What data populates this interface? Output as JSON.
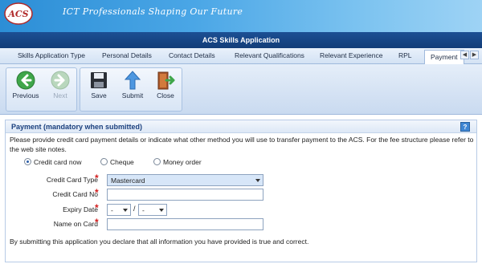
{
  "header": {
    "logo_text": "ACS",
    "tagline": "ICT Professionals Shaping Our Future"
  },
  "window": {
    "title": "ACS Skills Application"
  },
  "tabs": [
    {
      "label": "Skills Application Type"
    },
    {
      "label": "Personal Details"
    },
    {
      "label": "Contact Details"
    },
    {
      "label": "Relevant Qualifications"
    },
    {
      "label": "Relevant Experience"
    },
    {
      "label": "RPL"
    },
    {
      "label": "Payment",
      "active": true
    }
  ],
  "toolbar": {
    "previous_label": "Previous",
    "next_label": "Next",
    "save_label": "Save",
    "submit_label": "Submit",
    "close_label": "Close"
  },
  "section": {
    "title": "Payment (mandatory when submitted)",
    "help": "?",
    "intro": "Please provide credit card payment details or indicate what other method you will use to transfer payment to the ACS. For the fee structure please refer to the web site notes."
  },
  "payment_methods": [
    {
      "label": "Credit card now",
      "selected": true
    },
    {
      "label": "Cheque",
      "selected": false
    },
    {
      "label": "Money order",
      "selected": false
    }
  ],
  "form": {
    "card_type_label": "Credit Card Type",
    "card_type_value": "Mastercard",
    "card_no_label": "Credit Card No",
    "card_no_value": "",
    "expiry_label": "Expiry Date",
    "expiry_month": "-",
    "expiry_sep": "/",
    "expiry_year": "-",
    "name_label": "Name on Card",
    "name_value": "",
    "required_mark": "*"
  },
  "declaration": "By submitting this application you declare that all information you have provided is true and correct.",
  "colors": {
    "banner": "#2c8ed6",
    "titlebar": "#1c4f94",
    "required": "#d21c1c",
    "section_title": "#1a3f7d"
  }
}
